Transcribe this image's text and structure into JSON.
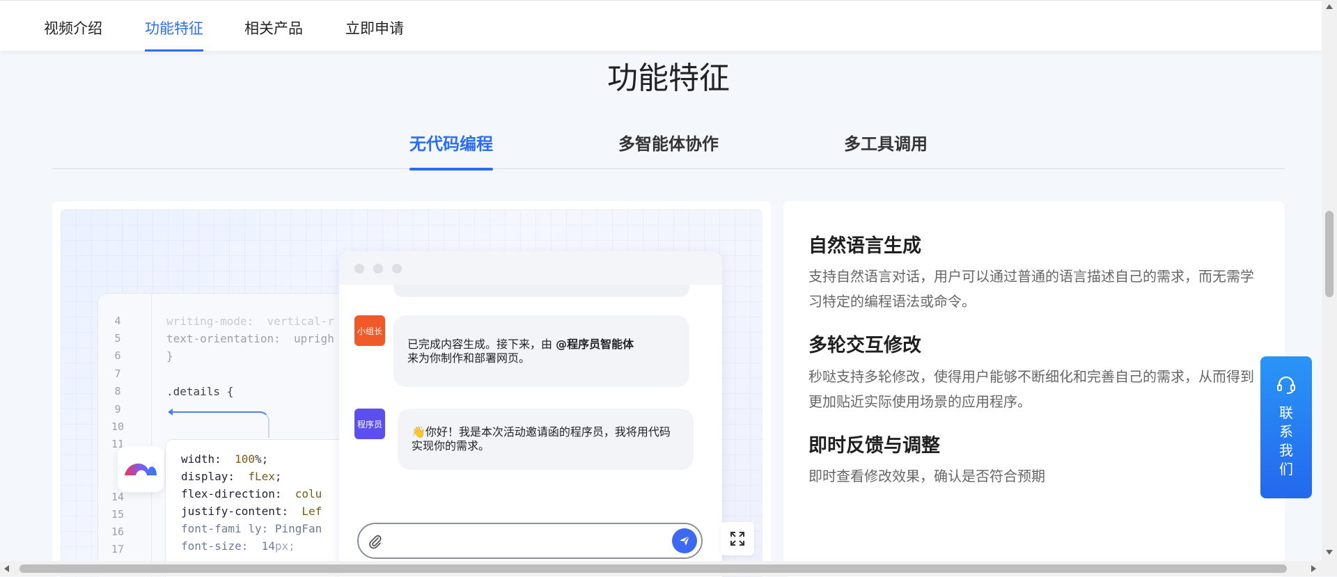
{
  "nav": {
    "tabs": [
      {
        "label": "视频介绍"
      },
      {
        "label": "功能特征"
      },
      {
        "label": "相关产品"
      },
      {
        "label": "立即申请"
      }
    ],
    "active": "功能特征"
  },
  "section": {
    "title": "功能特征"
  },
  "subtabs": [
    {
      "label": "无代码编程"
    },
    {
      "label": "多智能体协作"
    },
    {
      "label": "多工具调用"
    }
  ],
  "code": {
    "line_numbers": [
      "4",
      "5",
      "6",
      "7",
      "8",
      "9",
      "10",
      "11",
      "14",
      "15",
      "16",
      "17"
    ],
    "back_lines": [
      "writing-mode:  vertical-r",
      "text-orientation:  uprigh",
      "}",
      "",
      ".details {"
    ],
    "front": [
      {
        "prop": "width:",
        "val": "100",
        "unit": "%;"
      },
      {
        "prop": "display:",
        "val": "fLex",
        "unit": ";"
      },
      {
        "prop": "flex-direction:",
        "val": "colu",
        "unit": ""
      },
      {
        "prop": "justify-content:",
        "val": "Lef",
        "unit": ""
      },
      {
        "prop": "font-fami ly:",
        "val": "PingFan",
        "unit": ""
      },
      {
        "prop": "font-size:",
        "val": "14",
        "unit": "px;"
      }
    ]
  },
  "chat": {
    "messages": [
      {
        "avatar": "小组长",
        "avatar_color": "#f05a28",
        "text_before": "已完成内容生成。接下来，由 ",
        "text_bold": "@程序员智能体",
        "text_after": "来为你制作和部署网页。"
      },
      {
        "avatar": "程序员",
        "avatar_color": "#5b4ff0",
        "text": "👋你好！我是本次活动邀请函的程序员，我将用代码实现你的需求。"
      }
    ],
    "input_placeholder": ""
  },
  "features": [
    {
      "title": "自然语言生成",
      "desc": "支持自然语言对话，用户可以通过普通的语言描述自己的需求，而无需学习特定的编程语法或命令。"
    },
    {
      "title": "多轮交互修改",
      "desc": "秒哒支持多轮修改，使得用户能够不断细化和完善自己的需求，从而得到更加贴近实际使用场景的应用程序。"
    },
    {
      "title": "即时反馈与调整",
      "desc": "即时查看修改效果，确认是否符合预期"
    }
  ],
  "contact": {
    "label": "联系我们",
    "chars": [
      "联",
      "系",
      "我",
      "们"
    ]
  },
  "colors": {
    "accent": "#2a6df4",
    "background": "#f4f7fb"
  }
}
